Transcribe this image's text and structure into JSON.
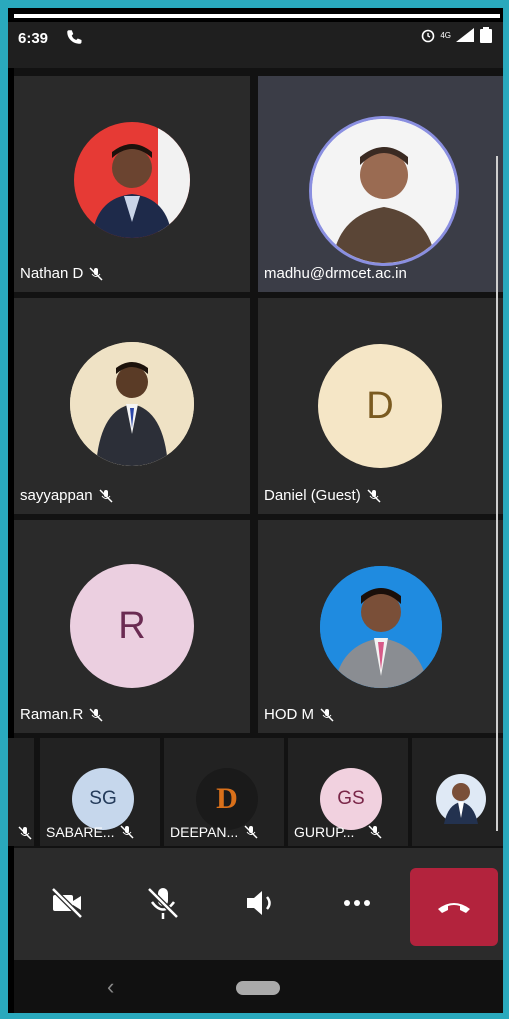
{
  "status": {
    "time": "6:39",
    "network": "4G"
  },
  "tiles": [
    {
      "name": "Nathan D",
      "kind": "photo"
    },
    {
      "name": "madhu@drmcet.ac.in",
      "kind": "photo"
    },
    {
      "name": "sayyappan",
      "kind": "photo"
    },
    {
      "name": "Daniel (Guest)",
      "kind": "initial",
      "initial": "D",
      "bg": "#f5e6c6",
      "fg": "#7a5a20"
    },
    {
      "name": "Raman.R",
      "kind": "initial",
      "initial": "R",
      "bg": "#ebcfe0",
      "fg": "#6a2b52"
    },
    {
      "name": "HOD M",
      "kind": "photo"
    }
  ],
  "strip": [
    {
      "initials": "SG",
      "name": "SABARE...",
      "bg": "#c6d7ec",
      "fg": "#243b5a"
    },
    {
      "initials": "D",
      "name": "DEEPAN...",
      "bg": "#1a1a1a",
      "fg": "#d9701a"
    },
    {
      "initials": "GS",
      "name": "GURUP...",
      "bg": "#f1d1df",
      "fg": "#7a2648"
    }
  ],
  "colors": {
    "hangup": "#b3233d",
    "speaker_ring": "#8a8fe0"
  },
  "icons": [
    "camera-off-icon",
    "mic-off-icon",
    "speaker-icon",
    "more-icon",
    "hang-up-icon"
  ]
}
